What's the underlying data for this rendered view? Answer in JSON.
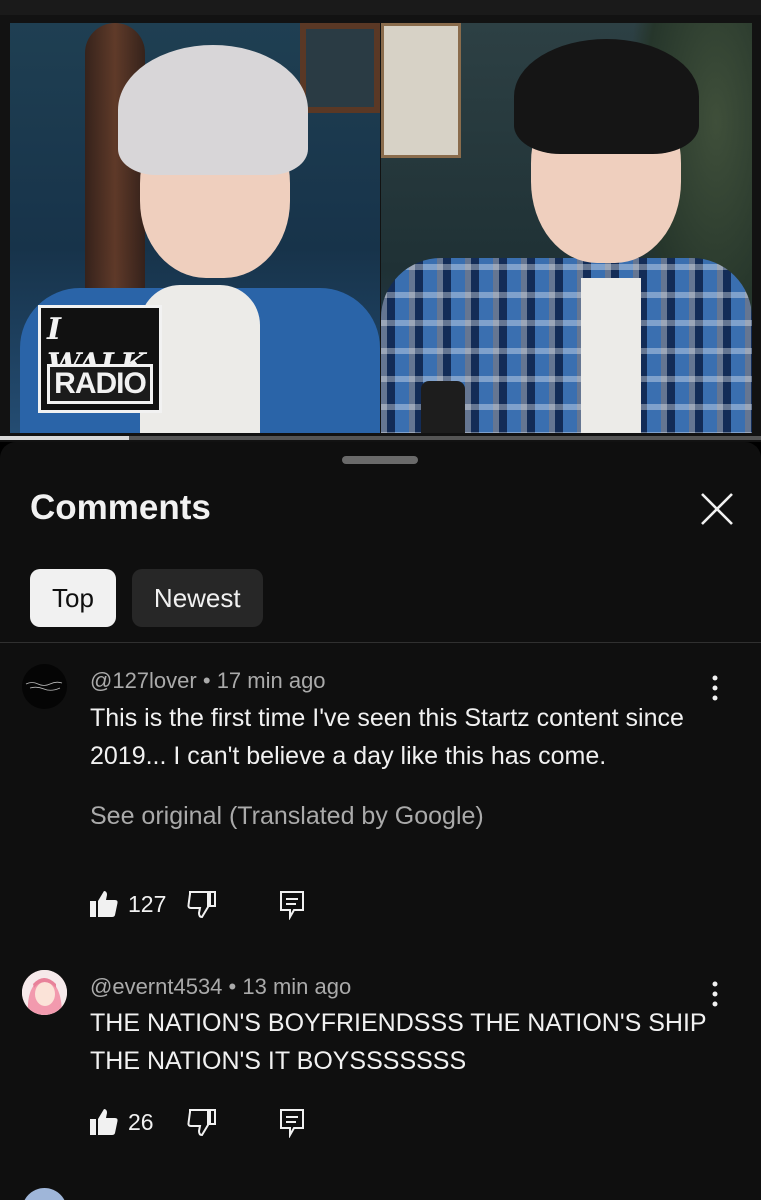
{
  "video": {
    "logo_top": "I WALK",
    "logo_bottom": "RADIO",
    "progress": 0.17
  },
  "comments_panel": {
    "title": "Comments",
    "close_icon": "close-icon",
    "sort_tabs": [
      {
        "label": "Top",
        "selected": true
      },
      {
        "label": "Newest",
        "selected": false
      }
    ]
  },
  "comments": [
    {
      "handle": "@127lover",
      "time": "17 min ago",
      "text": "This is the first time I've seen this Startz content since 2019... I can't believe a day like this has come.",
      "see_original": "See original (Translated by Google)",
      "likes": "127"
    },
    {
      "handle": "@evernt4534",
      "time": "13 min ago",
      "text": "THE NATION'S BOYFRIENDSSS THE NATION'S SHIP THE NATION'S IT BOYSSSSSSS",
      "likes": "26"
    }
  ],
  "icons": {
    "like": "thumbs-up-icon",
    "dislike": "thumbs-down-icon",
    "reply": "reply-icon",
    "more": "more-vert-icon"
  },
  "colors": {
    "background": "#0f0f0f",
    "chip_selected": "#f1f1f1",
    "chip_unselected": "#272727",
    "secondary_text": "#aaaaaa"
  }
}
